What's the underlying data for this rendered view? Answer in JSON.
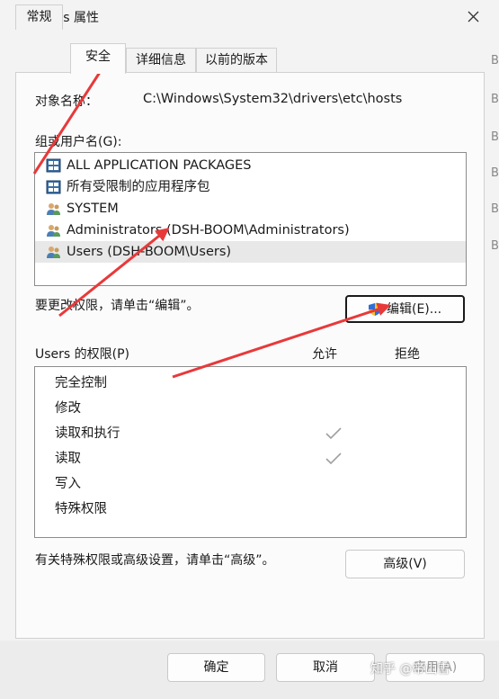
{
  "window": {
    "title": "hosts 属性",
    "close_label": "✕"
  },
  "tabs": [
    {
      "label": "常规",
      "active": false
    },
    {
      "label": "安全",
      "active": true
    },
    {
      "label": "详细信息",
      "active": false
    },
    {
      "label": "以前的版本",
      "active": false
    }
  ],
  "security": {
    "object_label": "对象名称：",
    "object_path": "C:\\Windows\\System32\\drivers\\etc\\hosts",
    "groups_label": "组或用户名(G):",
    "groups": [
      {
        "name": "ALL APPLICATION PACKAGES",
        "icon": "package-icon"
      },
      {
        "name": "所有受限制的应用程序包",
        "icon": "package-icon"
      },
      {
        "name": "SYSTEM",
        "icon": "users-icon"
      },
      {
        "name": "Administrators (DSH-BOOM\\Administrators)",
        "icon": "users-icon"
      },
      {
        "name": "Users (DSH-BOOM\\Users)",
        "icon": "users-icon",
        "selected": true
      }
    ],
    "edit_hint": "要更改权限，请单击“编辑”。",
    "edit_button": "编辑(E)...",
    "permissions_label": "Users 的权限(P)",
    "allow_header": "允许",
    "deny_header": "拒绝",
    "permissions": [
      {
        "name": "完全控制",
        "allow": false,
        "deny": false
      },
      {
        "name": "修改",
        "allow": false,
        "deny": false
      },
      {
        "name": "读取和执行",
        "allow": true,
        "deny": false
      },
      {
        "name": "读取",
        "allow": true,
        "deny": false
      },
      {
        "name": "写入",
        "allow": false,
        "deny": false
      },
      {
        "name": "特殊权限",
        "allow": false,
        "deny": false
      }
    ],
    "advanced_hint": "有关特殊权限或高级设置，请单击“高级”。",
    "advanced_button": "高级(V)"
  },
  "footer": {
    "ok": "确定",
    "cancel": "取消",
    "apply": "应用(A)"
  },
  "watermark": "知乎 @帝山雪",
  "background_fragments": [
    "B",
    "B",
    "B",
    "B",
    "B",
    "B"
  ],
  "colors": {
    "annotation_arrow": "#e8393a",
    "selected_row": "#e8e8e8",
    "check": "#a0a0a0"
  }
}
